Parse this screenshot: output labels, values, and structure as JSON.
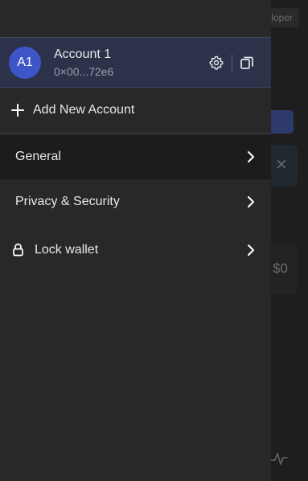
{
  "background": {
    "developer_badge": "loper",
    "blue_button_fragment": "e",
    "balance_fragment": "$0"
  },
  "account": {
    "avatar_initials": "A1",
    "name": "Account 1",
    "address": "0×00...72e6"
  },
  "drawer": {
    "add_account_label": "Add New Account",
    "menu": [
      {
        "label": "General",
        "icon": "none",
        "active": true
      },
      {
        "label": "Privacy & Security",
        "icon": "none",
        "active": false
      },
      {
        "label": "Lock wallet",
        "icon": "lock-icon",
        "active": false
      }
    ]
  },
  "colors": {
    "drawer_bg": "#282828",
    "account_row_bg": "#2c324a",
    "avatar_bg": "#3d55c9",
    "active_item_bg": "#1c1c1c"
  }
}
